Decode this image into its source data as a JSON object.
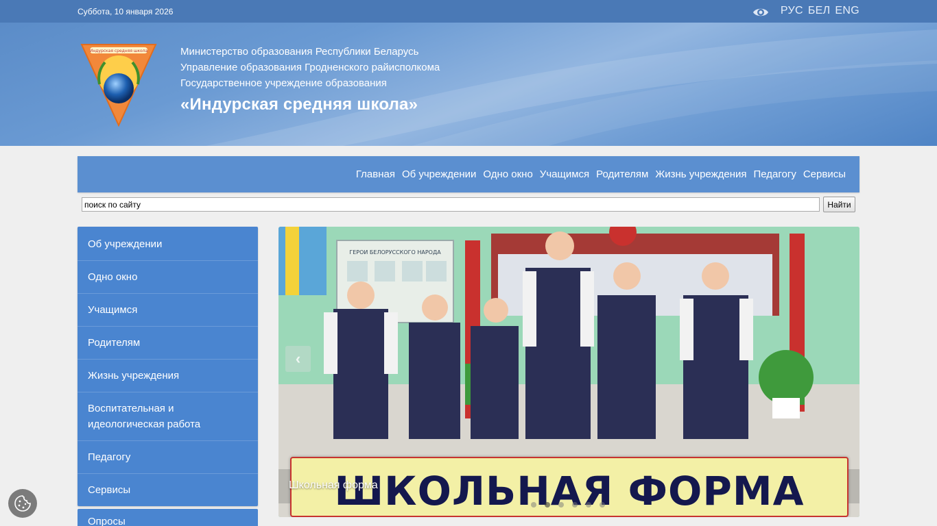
{
  "topbar": {
    "date": "Суббота, 10 января 2026",
    "languages": [
      "РУС",
      "БЕЛ",
      "ENG"
    ]
  },
  "header": {
    "line1": "Министерство образования Республики Беларусь",
    "line2": "Управление образования Гродненского райисполкома",
    "line3": "Государственное учреждение образования",
    "school_name": "«Индурская средняя школа»",
    "logo_text": "Индурская средняя школа"
  },
  "nav": {
    "items": [
      "Главная",
      "Об учреждении",
      "Одно окно",
      "Учащимся",
      "Родителям",
      "Жизнь учреждения",
      "Педагогу",
      "Сервисы"
    ]
  },
  "search": {
    "value": "поиск по сайту",
    "button_label": "Найти"
  },
  "sidebar": {
    "items": [
      "Об учреждении",
      "Одно окно",
      "Учащимся",
      "Родителям",
      "Жизнь учреждения",
      "Воспитательная и идеологическая работа",
      "Педагогу",
      "Сервисы"
    ],
    "polls_label": "Опросы"
  },
  "slider": {
    "caption": "Школьная форма",
    "banner_text": "ШКОЛЬНАЯ ФОРМА",
    "stand_text": "ГЕРОИ БЕЛОРУССКОГО НАРОДА",
    "slide_count": 6,
    "active_index": 1
  },
  "colors": {
    "topbar": "#4a79b6",
    "nav": "#5b8fd0",
    "sidebar": "#4a85d0",
    "banner_text": "#14184e"
  },
  "icons": {
    "eye": "eye-icon",
    "cookie": "cookie-icon",
    "prev": "chevron-left-icon"
  }
}
